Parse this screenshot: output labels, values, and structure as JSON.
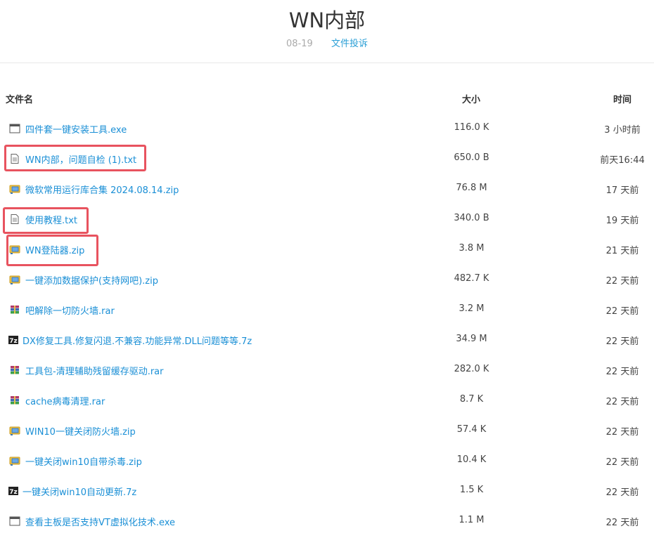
{
  "header": {
    "title": "WN内部",
    "date": "08-19",
    "report_link": "文件投诉"
  },
  "table": {
    "columns": {
      "name": "文件名",
      "size": "大小",
      "time": "时间"
    },
    "rows": [
      {
        "icon": "window-icon",
        "name": "四件套一键安装工具.exe",
        "size": "116.0 K",
        "time": "3 小时前"
      },
      {
        "icon": "text-file-icon",
        "name": "WN内部，问题自检 (1).txt",
        "size": "650.0 B",
        "time": "前天16:44"
      },
      {
        "icon": "zip-folder-icon",
        "name": "微软常用运行库合集 2024.08.14.zip",
        "size": "76.8 M",
        "time": "17 天前"
      },
      {
        "icon": "text-file-icon",
        "name": "使用教程.txt",
        "size": "340.0 B",
        "time": "19 天前"
      },
      {
        "icon": "zip-folder-icon",
        "name": "WN登陆器.zip",
        "size": "3.8 M",
        "time": "21 天前"
      },
      {
        "icon": "zip-folder-icon",
        "name": "一键添加数据保护(支持网吧).zip",
        "size": "482.7 K",
        "time": "22 天前"
      },
      {
        "icon": "rar-archive-icon",
        "name": "吧解除一切防火墙.rar",
        "size": "3.2 M",
        "time": "22 天前"
      },
      {
        "icon": "7z-archive-icon",
        "name": "DX修复工具.修复闪退.不兼容.功能异常.DLL问题等等.7z",
        "size": "34.9 M",
        "time": "22 天前"
      },
      {
        "icon": "rar-archive-icon",
        "name": "工具包-清理辅助残留缓存驱动.rar",
        "size": "282.0 K",
        "time": "22 天前"
      },
      {
        "icon": "rar-archive-icon",
        "name": "cache病毒清理.rar",
        "size": "8.7 K",
        "time": "22 天前"
      },
      {
        "icon": "zip-folder-icon",
        "name": "WIN10一键关闭防火墙.zip",
        "size": "57.4 K",
        "time": "22 天前"
      },
      {
        "icon": "zip-folder-icon",
        "name": "一键关闭win10自带杀毒.zip",
        "size": "10.4 K",
        "time": "22 天前"
      },
      {
        "icon": "7z-archive-icon",
        "name": "一键关闭win10自动更新.7z",
        "size": "1.5 K",
        "time": "22 天前"
      },
      {
        "icon": "window-icon",
        "name": "查看主板是否支持VT虚拟化技术.exe",
        "size": "1.1 M",
        "time": "22 天前"
      }
    ]
  },
  "colors": {
    "link": "#1a8fd6",
    "highlight": "#e8535f",
    "muted": "#aaaaaa"
  }
}
